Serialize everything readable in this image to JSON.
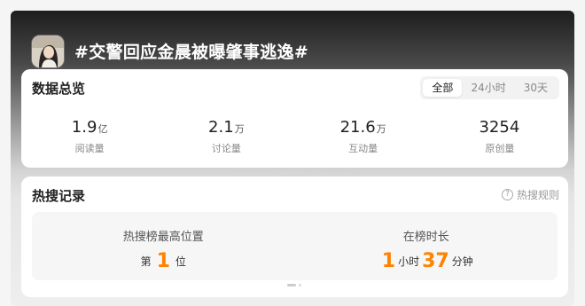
{
  "topic": {
    "title": "#交警回应金晨被曝肇事逃逸#"
  },
  "overview": {
    "title": "数据总览",
    "tabs": [
      "全部",
      "24小时",
      "30天"
    ],
    "active_tab": "全部",
    "stats": [
      {
        "value": "1.9",
        "unit": "亿",
        "label": "阅读量"
      },
      {
        "value": "2.1",
        "unit": "万",
        "label": "讨论量"
      },
      {
        "value": "21.6",
        "unit": "万",
        "label": "互动量"
      },
      {
        "value": "3254",
        "unit": "",
        "label": "原创量"
      }
    ]
  },
  "history": {
    "title": "热搜记录",
    "rules_link": "热搜规则",
    "highest_label": "热搜榜最高位置",
    "highest_prefix": "第",
    "highest_value": "1",
    "highest_suffix": "位",
    "duration_label": "在榜时长",
    "duration_hours": "1",
    "duration_hours_unit": "小时",
    "duration_minutes": "37",
    "duration_minutes_unit": "分钟"
  },
  "colors": {
    "accent": "#ff8200",
    "card": "#ffffff",
    "inner_box": "#f6f6f6"
  }
}
